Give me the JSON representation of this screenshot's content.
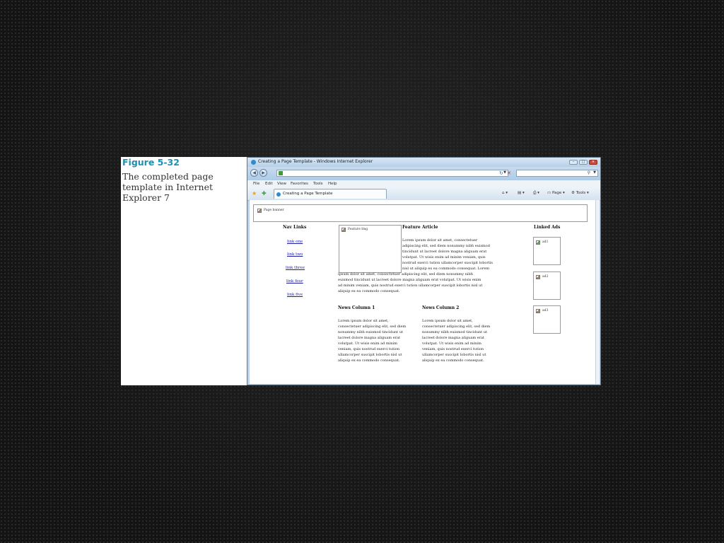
{
  "figure": {
    "label": "Figure 5-32",
    "caption": "The completed page template in Internet Explorer 7"
  },
  "browser": {
    "window_title": "Creating a Page Template - Windows Internet Explorer",
    "menu": [
      "File",
      "Edit",
      "View",
      "Favorites",
      "Tools",
      "Help"
    ],
    "tab_title": "Creating a Page Template",
    "toolbar": {
      "page_label": "Page",
      "tools_label": "Tools"
    }
  },
  "page": {
    "banner_alt": "Page banner",
    "nav": {
      "heading": "Nav Links",
      "links": [
        "link one",
        "link two",
        "link three",
        "link four",
        "link five"
      ]
    },
    "feature": {
      "image_alt": "Feature Img",
      "heading": "Feature Article",
      "lines": [
        "Lorem ipsum dolor sit amet, consectetuer",
        "adipiscing elit, sed diem nonummy nibh euismod",
        "tincidunt ut lacreet dolore magna aliguam erat",
        "volutpat. Ut wisis enim ad minim veniam, quis",
        "nostrud exerci tution ullamcorper suscipit lobortis",
        "nisl ut aliquip ex ea commodo consequat. Lorem",
        "ipsum dolor sit amet, consectetuer adipiscing elit, sed diem nonummy nibh",
        "euismod tincidunt ut lacreet dolore magna aliguam erat volutpat. Ut wisis enim",
        "ad minim veniam, quis nostrud exerci tution ullamcorper suscipit lobortis nisl ut",
        "aliquip ex ea commodo consequat."
      ]
    },
    "news1": {
      "heading": "News Column 1",
      "lines": [
        "Lorem ipsum dolor sit amet,",
        "consectetuer adipiscing elit, sed diem",
        "nonummy nibh euismod tincidunt ut",
        "lacreet dolore magna aliguam erat",
        "volutpat. Ut wisis enim ad minim",
        "veniam, quis nostrud exerci tution",
        "ullamcorper suscipit lobortis nisl ut",
        "aliquip ex ea commodo consequat."
      ]
    },
    "news2": {
      "heading": "News Column 2",
      "lines": [
        "Lorem ipsum dolor sit amet,",
        "consectetuer adipiscing elit, sed diem",
        "nonummy nibh euismod tincidunt ut",
        "lacreet dolore magna aliguam erat",
        "volutpat. Ut wisis enim ad minim",
        "veniam, quis nostrud exerci tution",
        "ullamcorper suscipit lobortis nisl ut",
        "aliquip ex ea commodo consequat."
      ]
    },
    "ads": {
      "heading": "Linked Ads",
      "items": [
        "ad1",
        "ad2",
        "ad3"
      ]
    }
  }
}
